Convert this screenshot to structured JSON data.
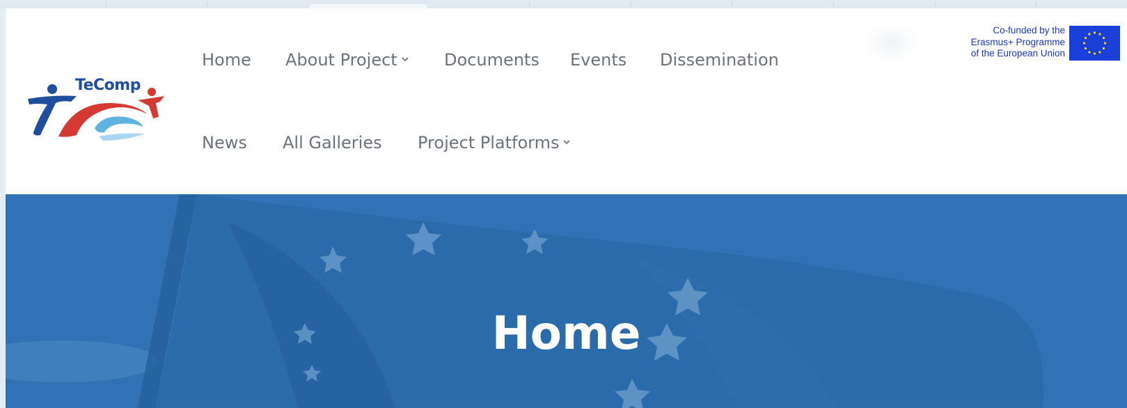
{
  "logo": {
    "text": "TeComp"
  },
  "nav": {
    "row1": [
      {
        "label": "Home",
        "has_dropdown": false
      },
      {
        "label": "About Project",
        "has_dropdown": true
      },
      {
        "label": "Documents",
        "has_dropdown": false
      },
      {
        "label": "Events",
        "has_dropdown": false
      },
      {
        "label": "Dissemination",
        "has_dropdown": false
      }
    ],
    "row2": [
      {
        "label": "News",
        "has_dropdown": false
      },
      {
        "label": "All Galleries",
        "has_dropdown": false
      },
      {
        "label": "Project Platforms",
        "has_dropdown": true
      }
    ]
  },
  "eu_banner": {
    "line1": "Co-funded by the",
    "line2": "Erasmus+ Programme",
    "line3": "of the European Union",
    "flag_icon": "eu-flag-icon"
  },
  "hero": {
    "title": "Home"
  },
  "colors": {
    "nav_text": "#6b7280",
    "hero_overlay": "#2f73b6",
    "eu_blue": "#1a37c9",
    "logo_blue": "#1f4e9e",
    "logo_red": "#d43a32"
  }
}
